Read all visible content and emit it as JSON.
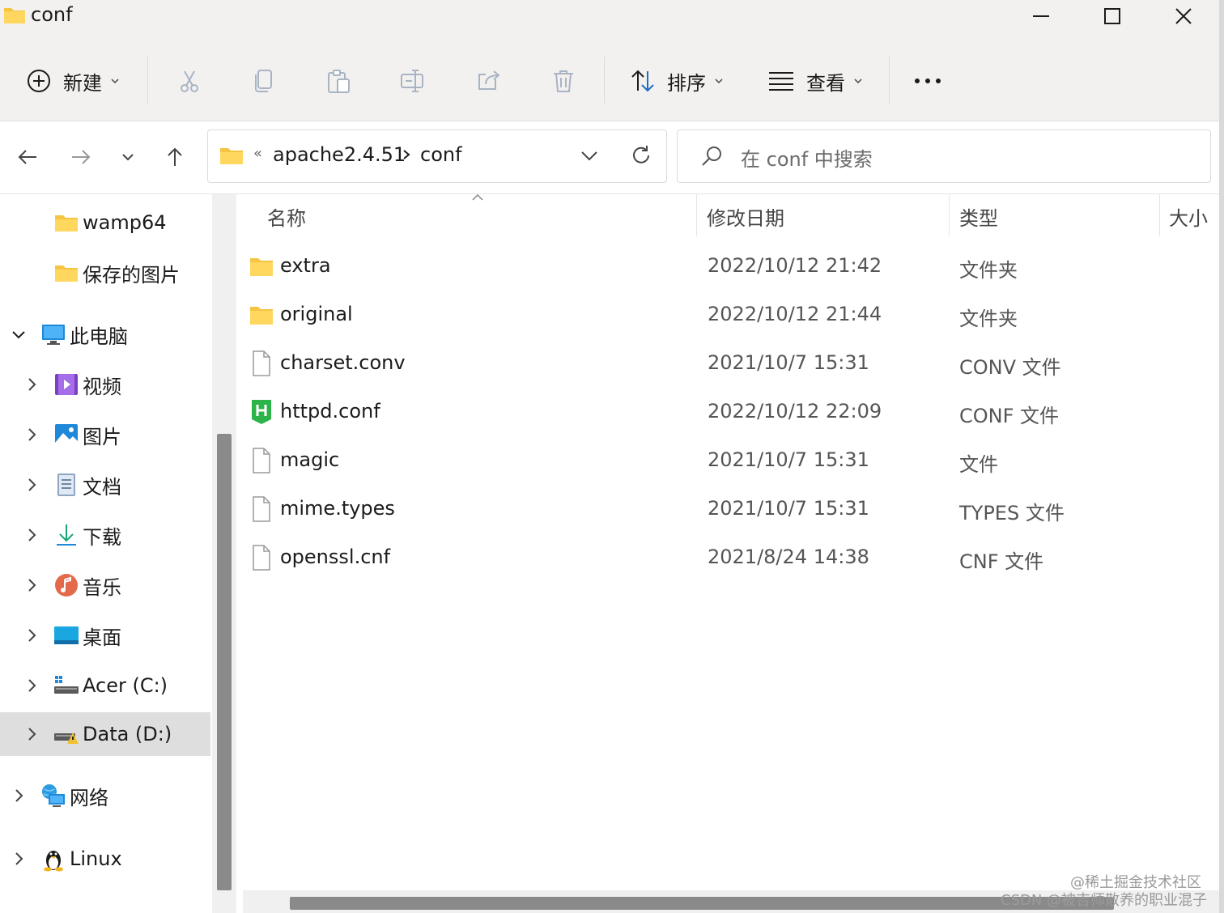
{
  "window": {
    "title": "conf",
    "minimize_icon": "minimize-icon",
    "maximize_icon": "maximize-icon",
    "close_icon": "close-icon"
  },
  "toolbar": {
    "new_label": "新建",
    "sort_label": "排序",
    "view_label": "查看",
    "more_icon": "more-icon",
    "icons": [
      "cut-icon",
      "copy-icon",
      "paste-icon",
      "rename-icon",
      "share-icon",
      "delete-icon"
    ]
  },
  "navigation": {
    "back_icon": "back-arrow-icon",
    "forward_icon": "forward-arrow-icon",
    "recent_icon": "chevron-down-icon",
    "up_icon": "up-arrow-icon"
  },
  "address_bar": {
    "overflow_glyph": "«",
    "segments": [
      "apache2.4.51",
      "conf"
    ]
  },
  "search": {
    "placeholder": "在 conf 中搜索"
  },
  "sidebar": {
    "items": [
      {
        "label": "wamp64",
        "icon": "folder-icon"
      },
      {
        "label": "保存的图片",
        "icon": "folder-icon"
      },
      {
        "label": "此电脑",
        "icon": "computer-icon",
        "expanded": true
      },
      {
        "label": "视频",
        "icon": "video-icon"
      },
      {
        "label": "图片",
        "icon": "pictures-icon"
      },
      {
        "label": "文档",
        "icon": "documents-icon"
      },
      {
        "label": "下载",
        "icon": "download-icon"
      },
      {
        "label": "音乐",
        "icon": "music-icon"
      },
      {
        "label": "桌面",
        "icon": "desktop-icon"
      },
      {
        "label": "Acer (C:)",
        "icon": "drive-icon"
      },
      {
        "label": "Data (D:)",
        "icon": "drive-warning-icon",
        "selected": true
      },
      {
        "label": "网络",
        "icon": "network-icon"
      },
      {
        "label": "Linux",
        "icon": "linux-icon"
      }
    ]
  },
  "columns": {
    "name": "名称",
    "date": "修改日期",
    "type": "类型",
    "size": "大小"
  },
  "files": [
    {
      "name": "extra",
      "date": "2022/10/12 21:42",
      "type": "文件夹",
      "icon": "folder-icon"
    },
    {
      "name": "original",
      "date": "2022/10/12 21:44",
      "type": "文件夹",
      "icon": "folder-icon"
    },
    {
      "name": "charset.conv",
      "date": "2021/10/7 15:31",
      "type": "CONV 文件",
      "icon": "file-icon"
    },
    {
      "name": "httpd.conf",
      "date": "2022/10/12 22:09",
      "type": "CONF 文件",
      "icon": "hbuilder-file-icon"
    },
    {
      "name": "magic",
      "date": "2021/10/7 15:31",
      "type": "文件",
      "icon": "file-icon"
    },
    {
      "name": "mime.types",
      "date": "2021/10/7 15:31",
      "type": "TYPES 文件",
      "icon": "file-icon"
    },
    {
      "name": "openssl.cnf",
      "date": "2021/8/24 14:38",
      "type": "CNF 文件",
      "icon": "file-icon"
    }
  ],
  "watermark": {
    "line1": "@稀土掘金技术社区",
    "line2": "CSDN @被吉师散养的职业混子"
  }
}
